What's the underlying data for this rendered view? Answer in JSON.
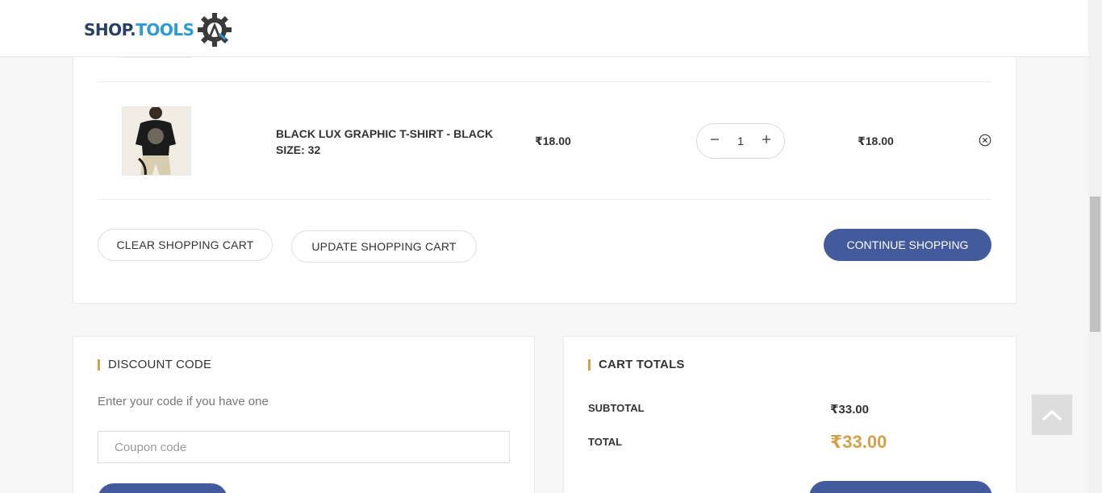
{
  "header": {
    "logo_part1": "SHOP.",
    "logo_part2": "TOOLS",
    "logo_icon": "gear-icon",
    "brand_colors": {
      "dark": "#2b3f63",
      "blue": "#2e9bd6"
    }
  },
  "cart": {
    "items": [
      {
        "name": "BLACK LUX GRAPHIC T-SHIRT - BLACK",
        "variant": "SIZE: 32",
        "price": "₹18.00",
        "quantity": "1",
        "total": "₹18.00",
        "remove_icon": "remove-circle-icon"
      }
    ],
    "clear_label": "CLEAR SHOPPING CART",
    "update_label": "UPDATE SHOPPING CART",
    "continue_label": "CONTINUE SHOPPING"
  },
  "discount": {
    "title": "DISCOUNT CODE",
    "help": "Enter your code if you have one",
    "placeholder": "Coupon code"
  },
  "totals": {
    "title": "CART TOTALS",
    "subtotal_label": "SUBTOTAL",
    "subtotal_value": "₹33.00",
    "total_label": "TOTAL",
    "total_value": "₹33.00"
  },
  "colors": {
    "primary_button": "#435a9c",
    "accent_gold": "#d2a24a"
  },
  "back_to_top_icon": "chevron-up-icon"
}
